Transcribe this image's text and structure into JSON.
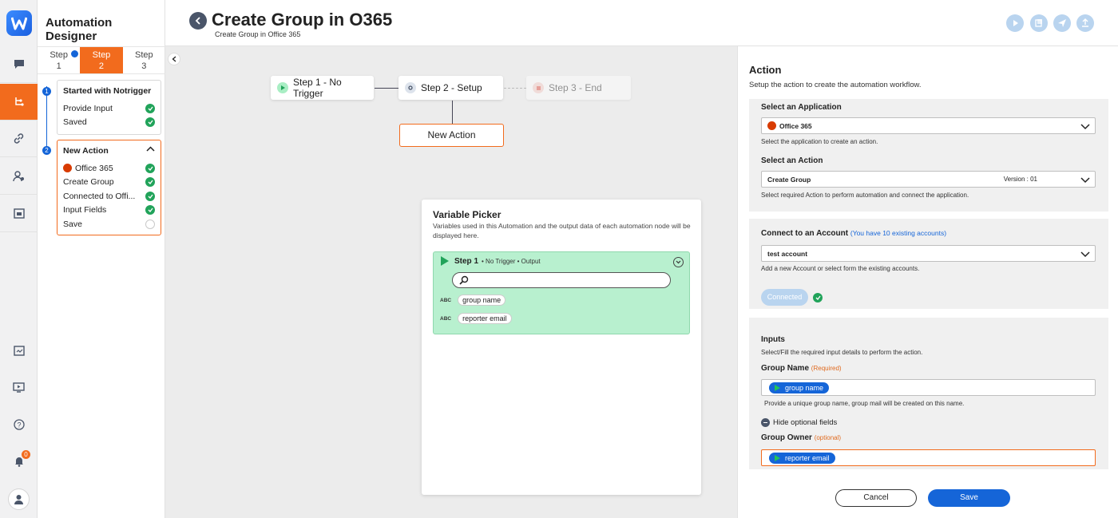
{
  "app": {
    "title": "Automation Designer",
    "notification_count": "0"
  },
  "steps_tabs": [
    {
      "line1": "Step",
      "line2": "1"
    },
    {
      "line1": "Step",
      "line2": "2"
    },
    {
      "line1": "Step",
      "line2": "3"
    }
  ],
  "timeline": {
    "card1": {
      "number": "1",
      "title": "Started with Notrigger",
      "items": [
        "Provide Input",
        "Saved"
      ]
    },
    "card2": {
      "number": "2",
      "title": "New Action",
      "items": [
        "Office 365",
        "Create Group",
        "Connected to Offi...",
        "Input Fields",
        "Save"
      ]
    }
  },
  "header": {
    "title": "Create Group in O365",
    "subtitle": "Create Group in Office 365"
  },
  "canvas": {
    "nodes": [
      "Step 1 - No Trigger",
      "Step 2 - Setup",
      "Step 3 - End"
    ],
    "new_action": "New Action"
  },
  "variable_picker": {
    "title": "Variable Picker",
    "description": "Variables used in this Automation and the output data of each automation node will be displayed here.",
    "step_label": "Step 1",
    "step_meta": "• No Trigger  • Output",
    "vars": [
      {
        "type": "ABC",
        "name": "group name"
      },
      {
        "type": "ABC",
        "name": "reporter email"
      }
    ]
  },
  "action_panel": {
    "title": "Action",
    "description": "Setup the action to create the automation workflow.",
    "select_app": {
      "label": "Select an Application",
      "value": "Office 365",
      "help": "Select the application to create an action."
    },
    "select_action": {
      "label": "Select an Action",
      "value": "Create Group",
      "version": "Version : 01",
      "help": "Select required Action to perform automation and connect the application."
    },
    "account": {
      "label": "Connect to an Account",
      "info": "(You have 10 existing accounts)",
      "value": "test account",
      "help": "Add a new Account or select form the existing accounts.",
      "status": "Connected"
    },
    "inputs": {
      "label": "Inputs",
      "help": "Select/Fill the required input details to perform the action.",
      "group_name": {
        "label": "Group Name",
        "tag": "(Required)",
        "chip": "group name",
        "help": "Provide a unique group name, group mail will be created on this name."
      },
      "optional_toggle": "Hide optional fields",
      "group_owner": {
        "label": "Group Owner",
        "tag": "(optional)",
        "chip": "reporter email"
      }
    },
    "cancel_label": "Cancel",
    "save_label": "Save"
  },
  "colors": {
    "accent": "#f26b1d",
    "primary": "#1565d8",
    "success": "#21a35a"
  }
}
